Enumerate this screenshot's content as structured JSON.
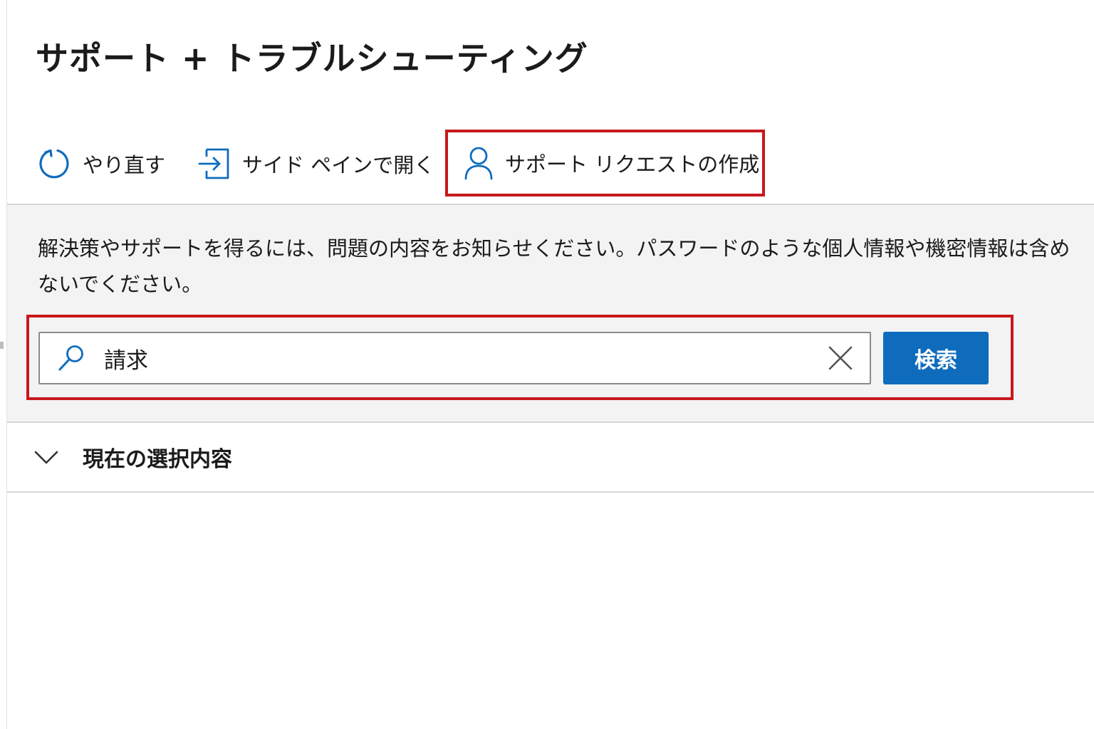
{
  "page": {
    "title": "サポート + トラブルシューティング"
  },
  "toolbar": {
    "retry_label": "やり直す",
    "open_side_pane_label": "サイド ペインで開く",
    "create_support_request_label": "サポート リクエストの作成"
  },
  "search_section": {
    "instruction": "解決策やサポートを得るには、問題の内容をお知らせください。パスワードのような個人情報や機密情報は含めないでください。",
    "input_value": "請求",
    "search_button_label": "検索"
  },
  "current_selection": {
    "label": "現在の選択内容",
    "expanded": false
  },
  "colors": {
    "accent": "#0f6cbd",
    "highlight_border": "#c8181c",
    "search_area_background": "#f3f3f3"
  },
  "icons": {
    "retry": "retry-icon",
    "side_pane": "open-side-pane-icon",
    "support_request": "person-icon",
    "search": "search-icon",
    "clear": "close-icon",
    "expand": "chevron-down-icon"
  }
}
